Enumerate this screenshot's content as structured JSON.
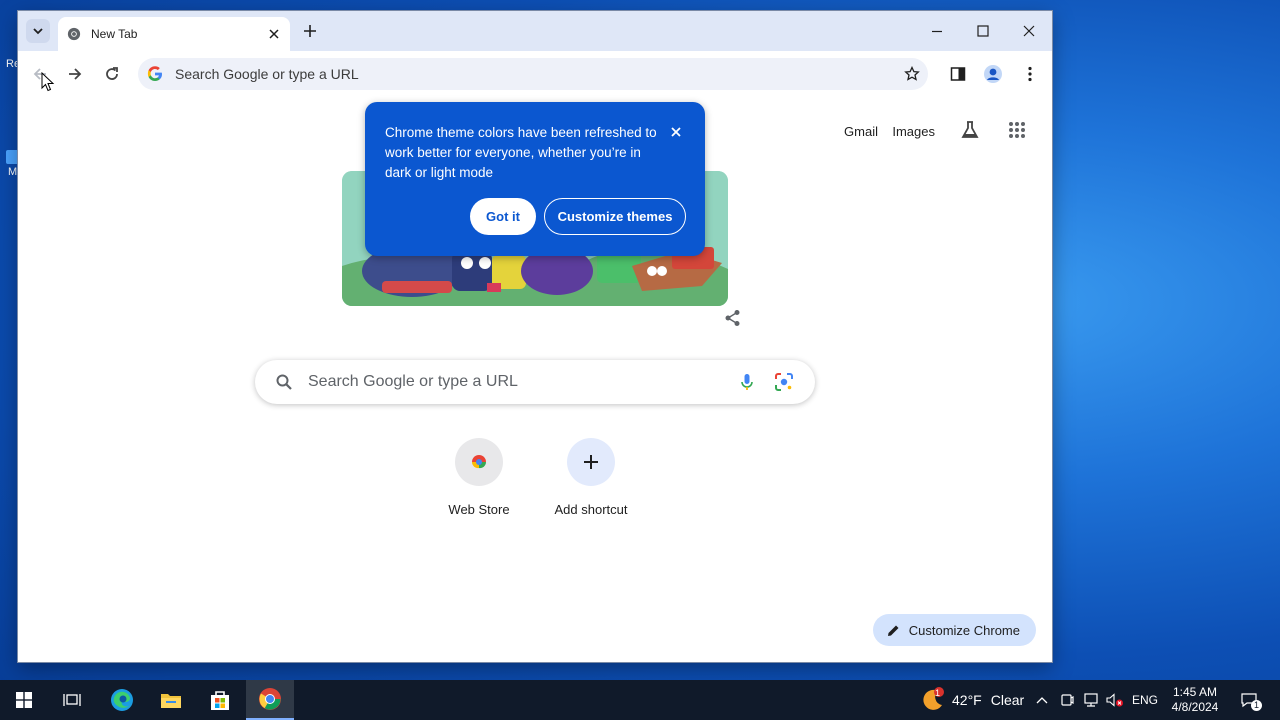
{
  "browser": {
    "tab_title": "New Tab",
    "address_placeholder": "Search Google or type a URL"
  },
  "ntp": {
    "gmail_link": "Gmail",
    "images_link": "Images",
    "search_placeholder": "Search Google or type a URL",
    "shortcuts": [
      {
        "label": "Web Store"
      },
      {
        "label": "Add shortcut"
      }
    ],
    "customize_chrome": "Customize Chrome"
  },
  "popup": {
    "message": "Chrome theme colors have been refreshed to work better for everyone, whether you’re in dark or light mode",
    "got_it": "Got it",
    "customize_themes": "Customize themes"
  },
  "taskbar": {
    "weather_temp": "42°F",
    "weather_desc": "Clear",
    "weather_alert_count": "1",
    "language": "ENG",
    "time": "1:45 AM",
    "date": "4/8/2024",
    "notification_count": "1"
  },
  "desktop_partial_labels": [
    "Re",
    "M"
  ],
  "colors": {
    "accent": "#0b57d0",
    "tabstrip": "#dfe7f7",
    "omnibox": "#eef1f9",
    "customize_button": "#d3e3fd",
    "taskbar": "#101a2a"
  }
}
